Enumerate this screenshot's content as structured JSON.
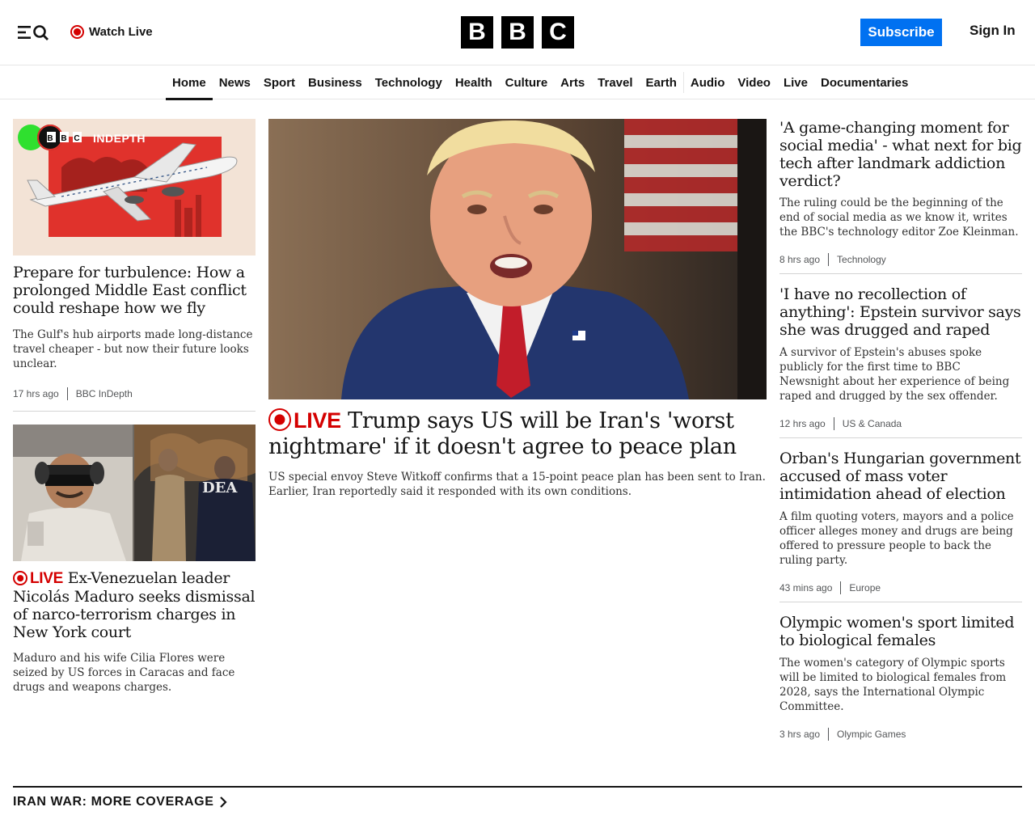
{
  "header": {
    "watch_live_label": "Watch Live",
    "logo_letters": [
      "B",
      "B",
      "C"
    ],
    "subscribe_label": "Subscribe",
    "signin_label": "Sign In",
    "brand_blue": "#0071f1",
    "live_red": "#d40000"
  },
  "nav": {
    "items": [
      "Home",
      "News",
      "Sport",
      "Business",
      "Technology",
      "Health",
      "Culture",
      "Arts",
      "Travel",
      "Earth",
      "Audio",
      "Video",
      "Live",
      "Documentaries"
    ],
    "active": "Home"
  },
  "left_column": {
    "story1": {
      "thumb_label": "INDEPTH",
      "thumb_logo": "BBC",
      "headline": "Prepare for turbulence: How a prolonged Middle East conflict could reshape how we fly",
      "summary": "The Gulf's hub airports made long-distance travel cheaper - but now their future looks unclear.",
      "time": "17 hrs ago",
      "section": "BBC InDepth"
    },
    "story2": {
      "live_label": "LIVE",
      "thumb_text": "DEA",
      "headline": "Ex-Venezuelan leader Nicolás Maduro seeks dismissal of narco-terrorism charges in New York court",
      "summary": "Maduro and his wife Cilia Flores were seized by US forces in Caracas and face drugs and weapons charges."
    }
  },
  "lead": {
    "live_label": "LIVE",
    "headline": "Trump says US will be Iran's 'worst nightmare' if it doesn't agree to peace plan",
    "summary": "US special envoy Steve Witkoff confirms that a 15-point peace plan has been sent to Iran. Earlier, Iran reportedly said it responded with its own conditions."
  },
  "right_column": [
    {
      "headline": "'A game-changing moment for social media' - what next for big tech after landmark addiction verdict?",
      "summary": "The ruling could be the beginning of the end of social media as we know it, writes the BBC's technology editor Zoe Kleinman.",
      "time": "8 hrs ago",
      "section": "Technology"
    },
    {
      "headline": "'I have no recollection of anything': Epstein survivor says she was drugged and raped",
      "summary": "A survivor of Epstein's abuses spoke publicly for the first time to BBC Newsnight about her experience of being raped and drugged by the sex offender.",
      "time": "12 hrs ago",
      "section": "US & Canada"
    },
    {
      "headline": "Orban's Hungarian government accused of mass voter intimidation ahead of election",
      "summary": "A film quoting voters, mayors and a police officer alleges money and drugs are being offered to pressure people to back the ruling party.",
      "time": "43 mins ago",
      "section": "Europe"
    },
    {
      "headline": "Olympic women's sport limited to biological females",
      "summary": "The women's category of Olympic sports will be limited to biological females from 2028, says the International Olympic Committee.",
      "time": "3 hrs ago",
      "section": "Olympic Games"
    }
  ],
  "more_coverage": {
    "label": "IRAN WAR: MORE COVERAGE"
  }
}
